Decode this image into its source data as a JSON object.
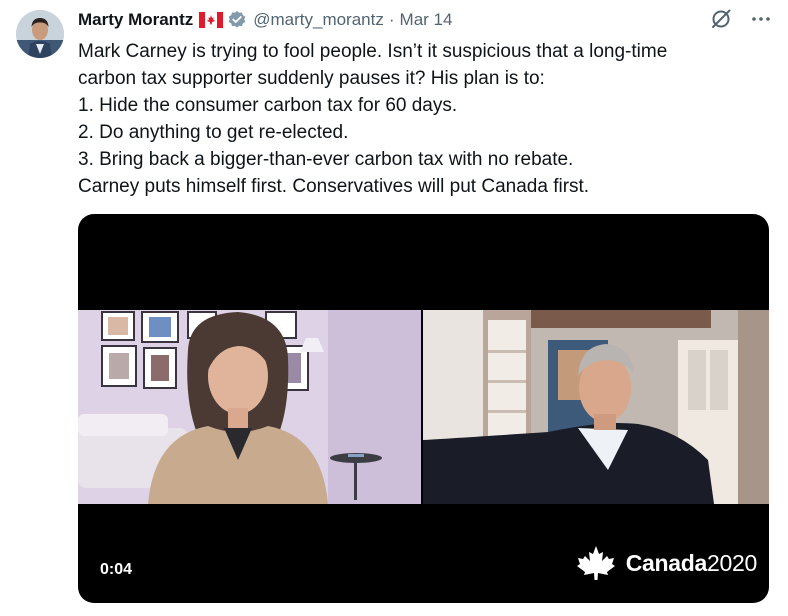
{
  "author": {
    "name": "Marty Morantz",
    "handle": "@marty_morantz",
    "separator": "·",
    "date": "Mar 14"
  },
  "tweet": {
    "lines": [
      "Mark Carney is trying to fool people. Isn’t it suspicious that a long-time",
      "carbon tax supporter suddenly pauses it? His plan is to:",
      "1. Hide the consumer carbon tax for 60 days.",
      "2. Do anything to get re-elected.",
      "3. Bring back a bigger-than-ever carbon tax with no rebate.",
      "Carney puts himself first. Conservatives will put Canada first."
    ]
  },
  "video": {
    "timestamp": "0:04",
    "brand_name": "Canada",
    "brand_year": "2020"
  },
  "colors": {
    "text": "#0f1419",
    "secondary": "#536471",
    "verified_badge": "#829aab",
    "flag_red": "#e0192b",
    "video_bg": "#000000"
  },
  "icons": [
    "grok-icon",
    "more-icon",
    "verified-badge-icon",
    "canada-flag-icon",
    "maple-leaf-icon"
  ]
}
